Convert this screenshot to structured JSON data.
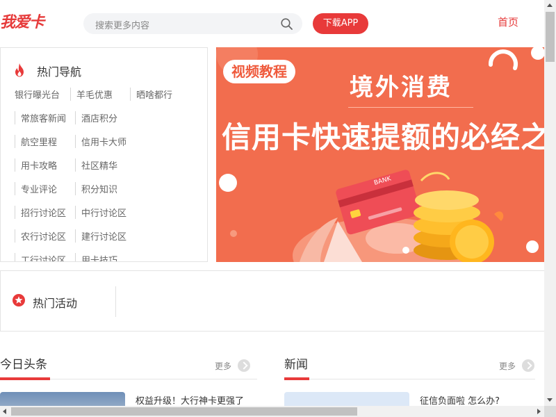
{
  "header": {
    "logo": "我爱卡",
    "search_placeholder": "搜索更多内容",
    "download_label": "下载APP",
    "home_label": "首页"
  },
  "hot_nav": {
    "title": "热门导航",
    "rows": [
      [
        "银行曝光台",
        "羊毛优惠",
        "晒啥都行"
      ],
      [
        "常旅客新闻",
        "酒店积分"
      ],
      [
        "航空里程",
        "信用卡大师"
      ],
      [
        "用卡攻略",
        "社区精华"
      ],
      [
        "专业评论",
        "积分知识"
      ],
      [
        "招行讨论区",
        "中行讨论区"
      ],
      [
        "农行讨论区",
        "建行讨论区"
      ],
      [
        "工行讨论区",
        "用卡技巧"
      ]
    ]
  },
  "banner": {
    "tag": "视频教程",
    "title_line1": "境外消费",
    "title_line2": "信用卡快速提额的必经之",
    "card_text": "BANK",
    "colors": {
      "background": "#f26d4e",
      "coin": "#ffb61e"
    }
  },
  "activity": {
    "title": "热门活动"
  },
  "sections": [
    {
      "title": "今日头条",
      "more": "更多",
      "headline": "权益升级！大行神卡更强了"
    },
    {
      "title": "新闻",
      "more": "更多",
      "headline": "征信负面啦 怎么办?"
    }
  ],
  "colors": {
    "accent": "#e83a3a"
  }
}
